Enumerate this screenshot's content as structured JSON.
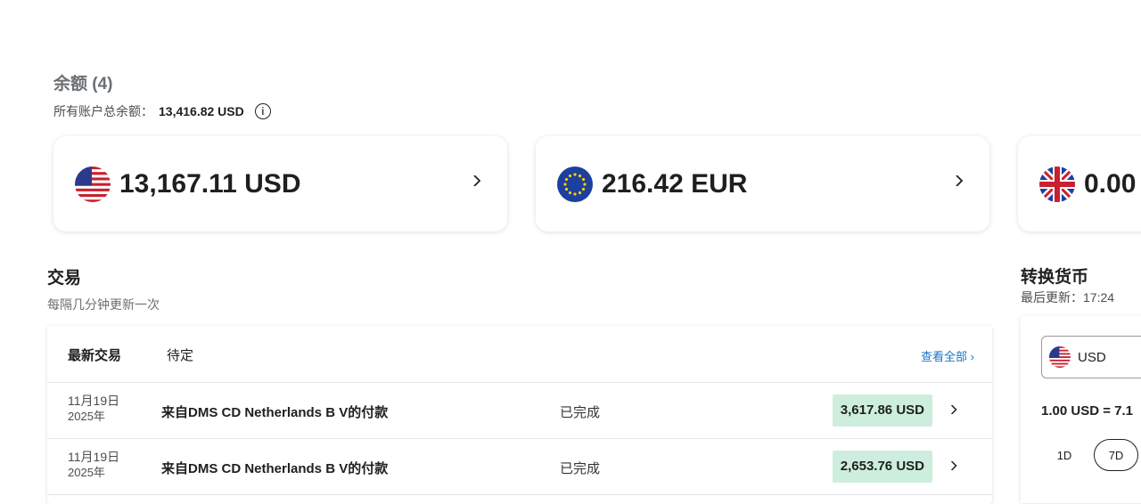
{
  "balances": {
    "title": "余额 (4)",
    "total_label": "所有账户总余额：",
    "total_amount": "13,416.82 USD",
    "info_icon": "i",
    "cards": [
      {
        "currency": "USD",
        "amount": "13,167.11 USD",
        "flag": "us-flag-icon"
      },
      {
        "currency": "EUR",
        "amount": "216.42 EUR",
        "flag": "eu-flag-icon"
      },
      {
        "currency": "GBP",
        "amount": "0.00",
        "flag": "uk-flag-icon"
      }
    ]
  },
  "transactions": {
    "title": "交易",
    "subtitle": "每隔几分钟更新一次",
    "tabs": [
      {
        "label": "最新交易",
        "active": true
      },
      {
        "label": "待定",
        "active": false
      }
    ],
    "view_all": "查看全部 ›",
    "rows": [
      {
        "date": "11月19日",
        "year": "2025年",
        "description": "来自DMS CD Netherlands B V的付款",
        "status": "已完成",
        "amount": "3,617.86 USD"
      },
      {
        "date": "11月19日",
        "year": "2025年",
        "description": "来自DMS CD Netherlands B V的付款",
        "status": "已完成",
        "amount": "2,653.76 USD"
      }
    ]
  },
  "convert": {
    "title": "转换货币",
    "updated": "最后更新：17:24",
    "from_currency": "USD",
    "rate": "1.00 USD = 7.1",
    "ranges": [
      "1D",
      "7D"
    ],
    "selected_range": "7D"
  },
  "colors": {
    "accent": "#1a73c9",
    "amount_badge": "#cdeedd"
  }
}
